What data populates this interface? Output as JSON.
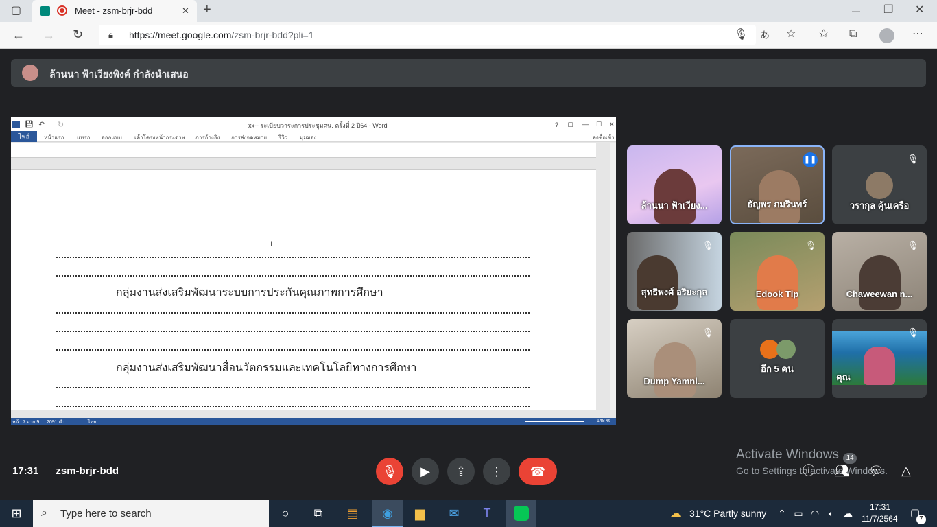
{
  "browser": {
    "tab_title": "Meet - zsm-brjr-bdd",
    "url_host": "https://meet.google.com",
    "url_path": "/zsm-brjr-bdd?pli=1",
    "new_tab": "+",
    "window": {
      "minimize": "—",
      "restore": "❐",
      "close": "✕"
    }
  },
  "meet": {
    "presenting_text": "ล้านนา ฟ้าเวียงพิงค์ กำลังนำเสนอ",
    "time": "17:31",
    "meeting_code": "zsm-brjr-bdd",
    "participant_count": "14",
    "tiles": [
      {
        "name": "ล้านนา ฟ้าเวียง..."
      },
      {
        "name": "ธัญพร ภมรินทร์"
      },
      {
        "name": "วรากุล คุ้นเครือ"
      },
      {
        "name": "สุทธิพงศ์ อริยะกุล"
      },
      {
        "name": "Edook Tip"
      },
      {
        "name": "Chaweewan n..."
      },
      {
        "name": "Dump Yamni..."
      },
      {
        "name": "อีก 5 คน"
      },
      {
        "name": "คุณ"
      }
    ]
  },
  "word": {
    "title": "xx-- ระเบียบวาระการประชุมศน. ครั้งที่ 2 ปี64 - Word",
    "ribbon_file": "ไฟล์",
    "ribbon_tabs": [
      "หน้าแรก",
      "แทรก",
      "ออกแบบ",
      "เค้าโครงหน้ากระดาษ",
      "การอ้างอิง",
      "การส่งจดหมาย",
      "รีวิว",
      "มุมมอง"
    ],
    "signin": "ลงชื่อเข้า",
    "doc_lines": [
      "กลุ่มงานส่งเสริมพัฒนาระบบการประกันคุณภาพการศึกษา",
      "กลุ่มงานส่งเสริมพัฒนาสื่อนวัตกรรมและเทคโนโลยีทางการศึกษา"
    ],
    "status_page": "หน้า 7 จาก 9",
    "status_words": "2091 คำ",
    "status_lang": "ไทย",
    "zoom": "148 %"
  },
  "activate": {
    "line1": "Activate Windows",
    "line2": "Go to Settings to activate Windows."
  },
  "taskbar": {
    "search_placeholder": "Type here to search",
    "weather": "31°C  Partly sunny",
    "clock_time": "17:31",
    "clock_date": "11/7/2564",
    "notif_count": "7"
  },
  "colors": {
    "end_call": "#ea4335",
    "mic_off": "#ea4335",
    "accent_blue": "#8ab4f8",
    "word_blue": "#2b579a"
  }
}
